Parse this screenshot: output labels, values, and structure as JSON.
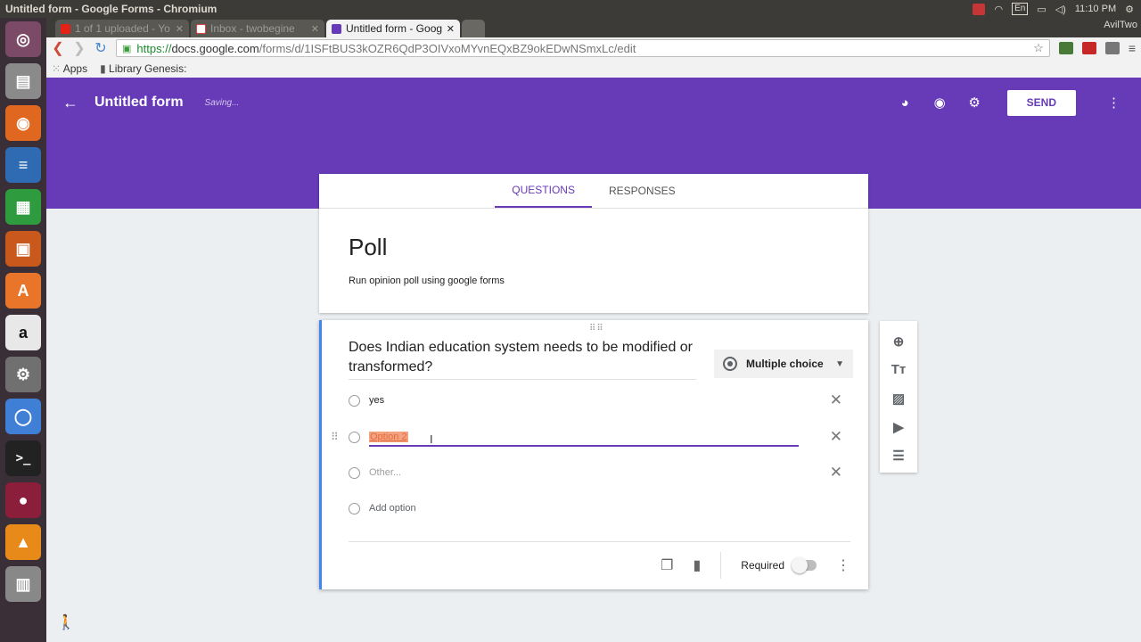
{
  "os": {
    "window_title": "Untitled form - Google Forms - Chromium",
    "clock": "11:10 PM",
    "keyboard": "En",
    "user": "AvilTwo"
  },
  "browser": {
    "tabs": [
      {
        "label": "1 of 1 uploaded - Yo",
        "icon": "youtube-icon",
        "active": false
      },
      {
        "label": "Inbox - twobegine",
        "icon": "gmail-icon",
        "active": false
      },
      {
        "label": "Untitled form - Goog",
        "icon": "forms-icon",
        "active": true
      }
    ],
    "url_scheme": "https://",
    "url_host": "docs.google.com",
    "url_path": "/forms/d/1ISFtBUS3kOZR6QdP3OIVxoMYvnEQxBZ9okEDwNSmxLc/edit",
    "bookmarks": [
      "Apps",
      "Library Genesis:"
    ]
  },
  "header": {
    "title": "Untitled form",
    "status": "Saving...",
    "send_label": "SEND"
  },
  "form": {
    "tabs": [
      "QUESTIONS",
      "RESPONSES"
    ],
    "active_tab": "QUESTIONS",
    "title": "Poll",
    "description": "Run opinion poll using google forms"
  },
  "question": {
    "text": "Does Indian education system needs to be modified or transformed?",
    "type": "Multiple choice",
    "options": [
      "yes",
      "Option 2"
    ],
    "other_placeholder": "Other...",
    "add_option": "Add option",
    "required_label": "Required",
    "required": false
  },
  "colors": {
    "accent": "#673ab7",
    "question_border": "#4285f4"
  }
}
